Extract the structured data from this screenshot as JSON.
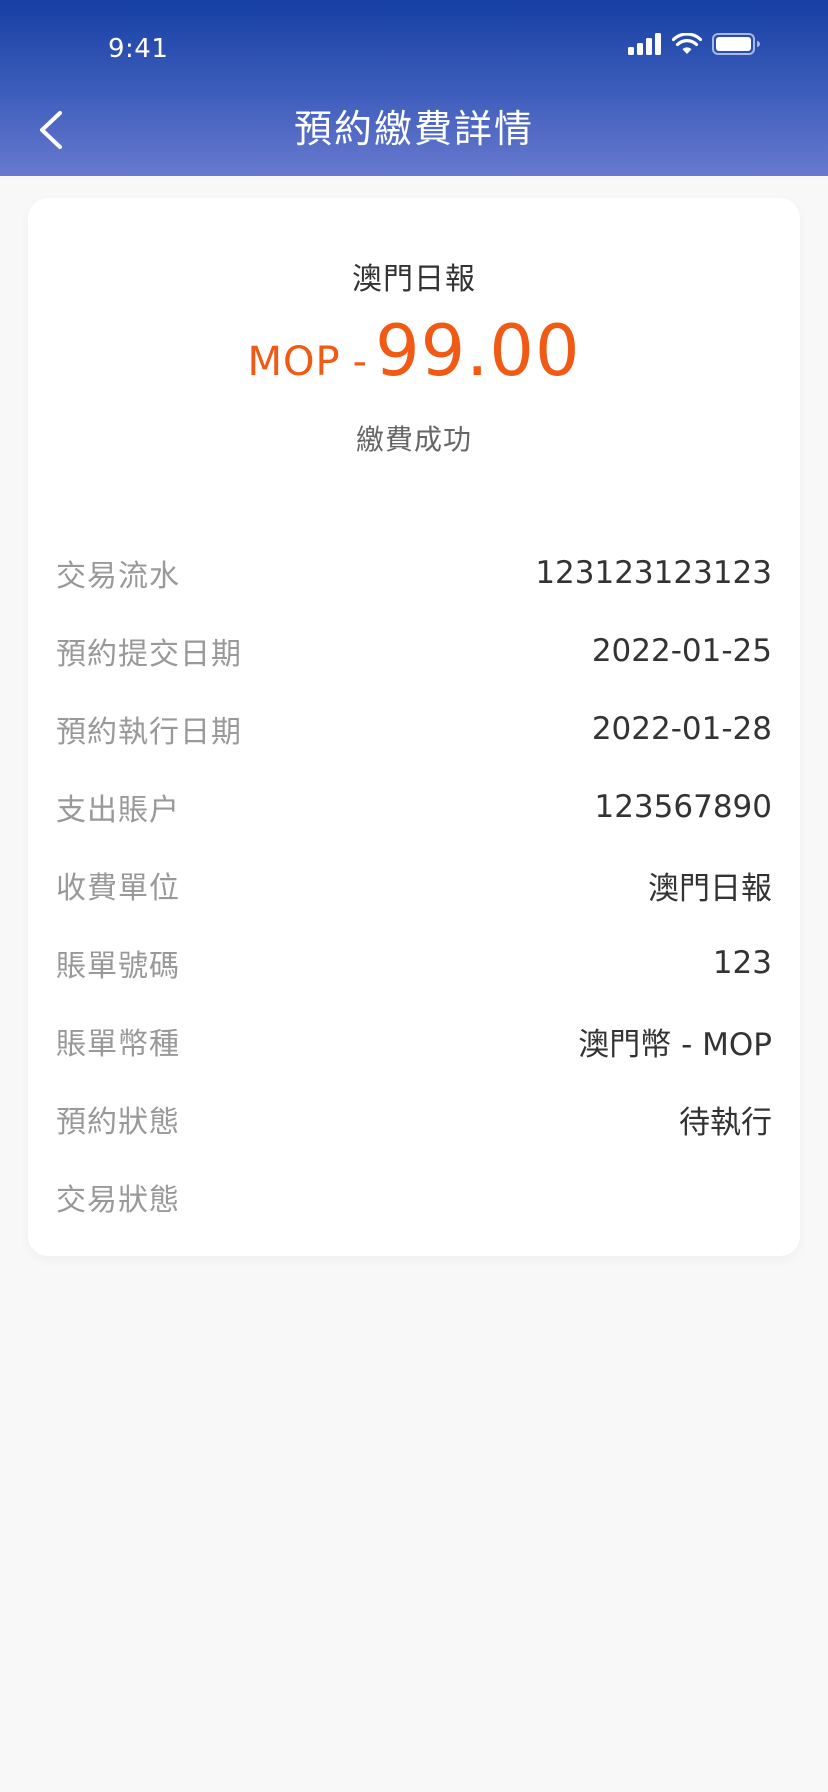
{
  "status_bar": {
    "time": "9:41"
  },
  "header": {
    "title": "預約繳費詳情"
  },
  "summary": {
    "merchant": "澳門日報",
    "currency": "MOP",
    "sign": "-",
    "amount": "99.00",
    "status": "繳費成功",
    "accent_color": "#f05a14"
  },
  "details": [
    {
      "label": "交易流水",
      "value": "123123123123"
    },
    {
      "label": "預約提交日期",
      "value": "2022-01-25"
    },
    {
      "label": "預約執行日期",
      "value": "2022-01-28"
    },
    {
      "label": "支出賬户",
      "value": "123567890"
    },
    {
      "label": "收費單位",
      "value": "澳門日報"
    },
    {
      "label": "賬單號碼",
      "value": "123"
    },
    {
      "label": "賬單幣種",
      "value": "澳門幣 - MOP"
    },
    {
      "label": "預約狀態",
      "value": "待執行"
    },
    {
      "label": "交易狀態",
      "value": ""
    }
  ],
  "icons": {
    "back": "chevron-left-icon",
    "signal": "cellular-signal-icon",
    "wifi": "wifi-icon",
    "battery": "battery-icon"
  },
  "colors": {
    "header_top": "#163fa4",
    "header_bottom": "#6879cf",
    "background": "#f8f8f8",
    "label": "#999999",
    "value": "#333333"
  }
}
